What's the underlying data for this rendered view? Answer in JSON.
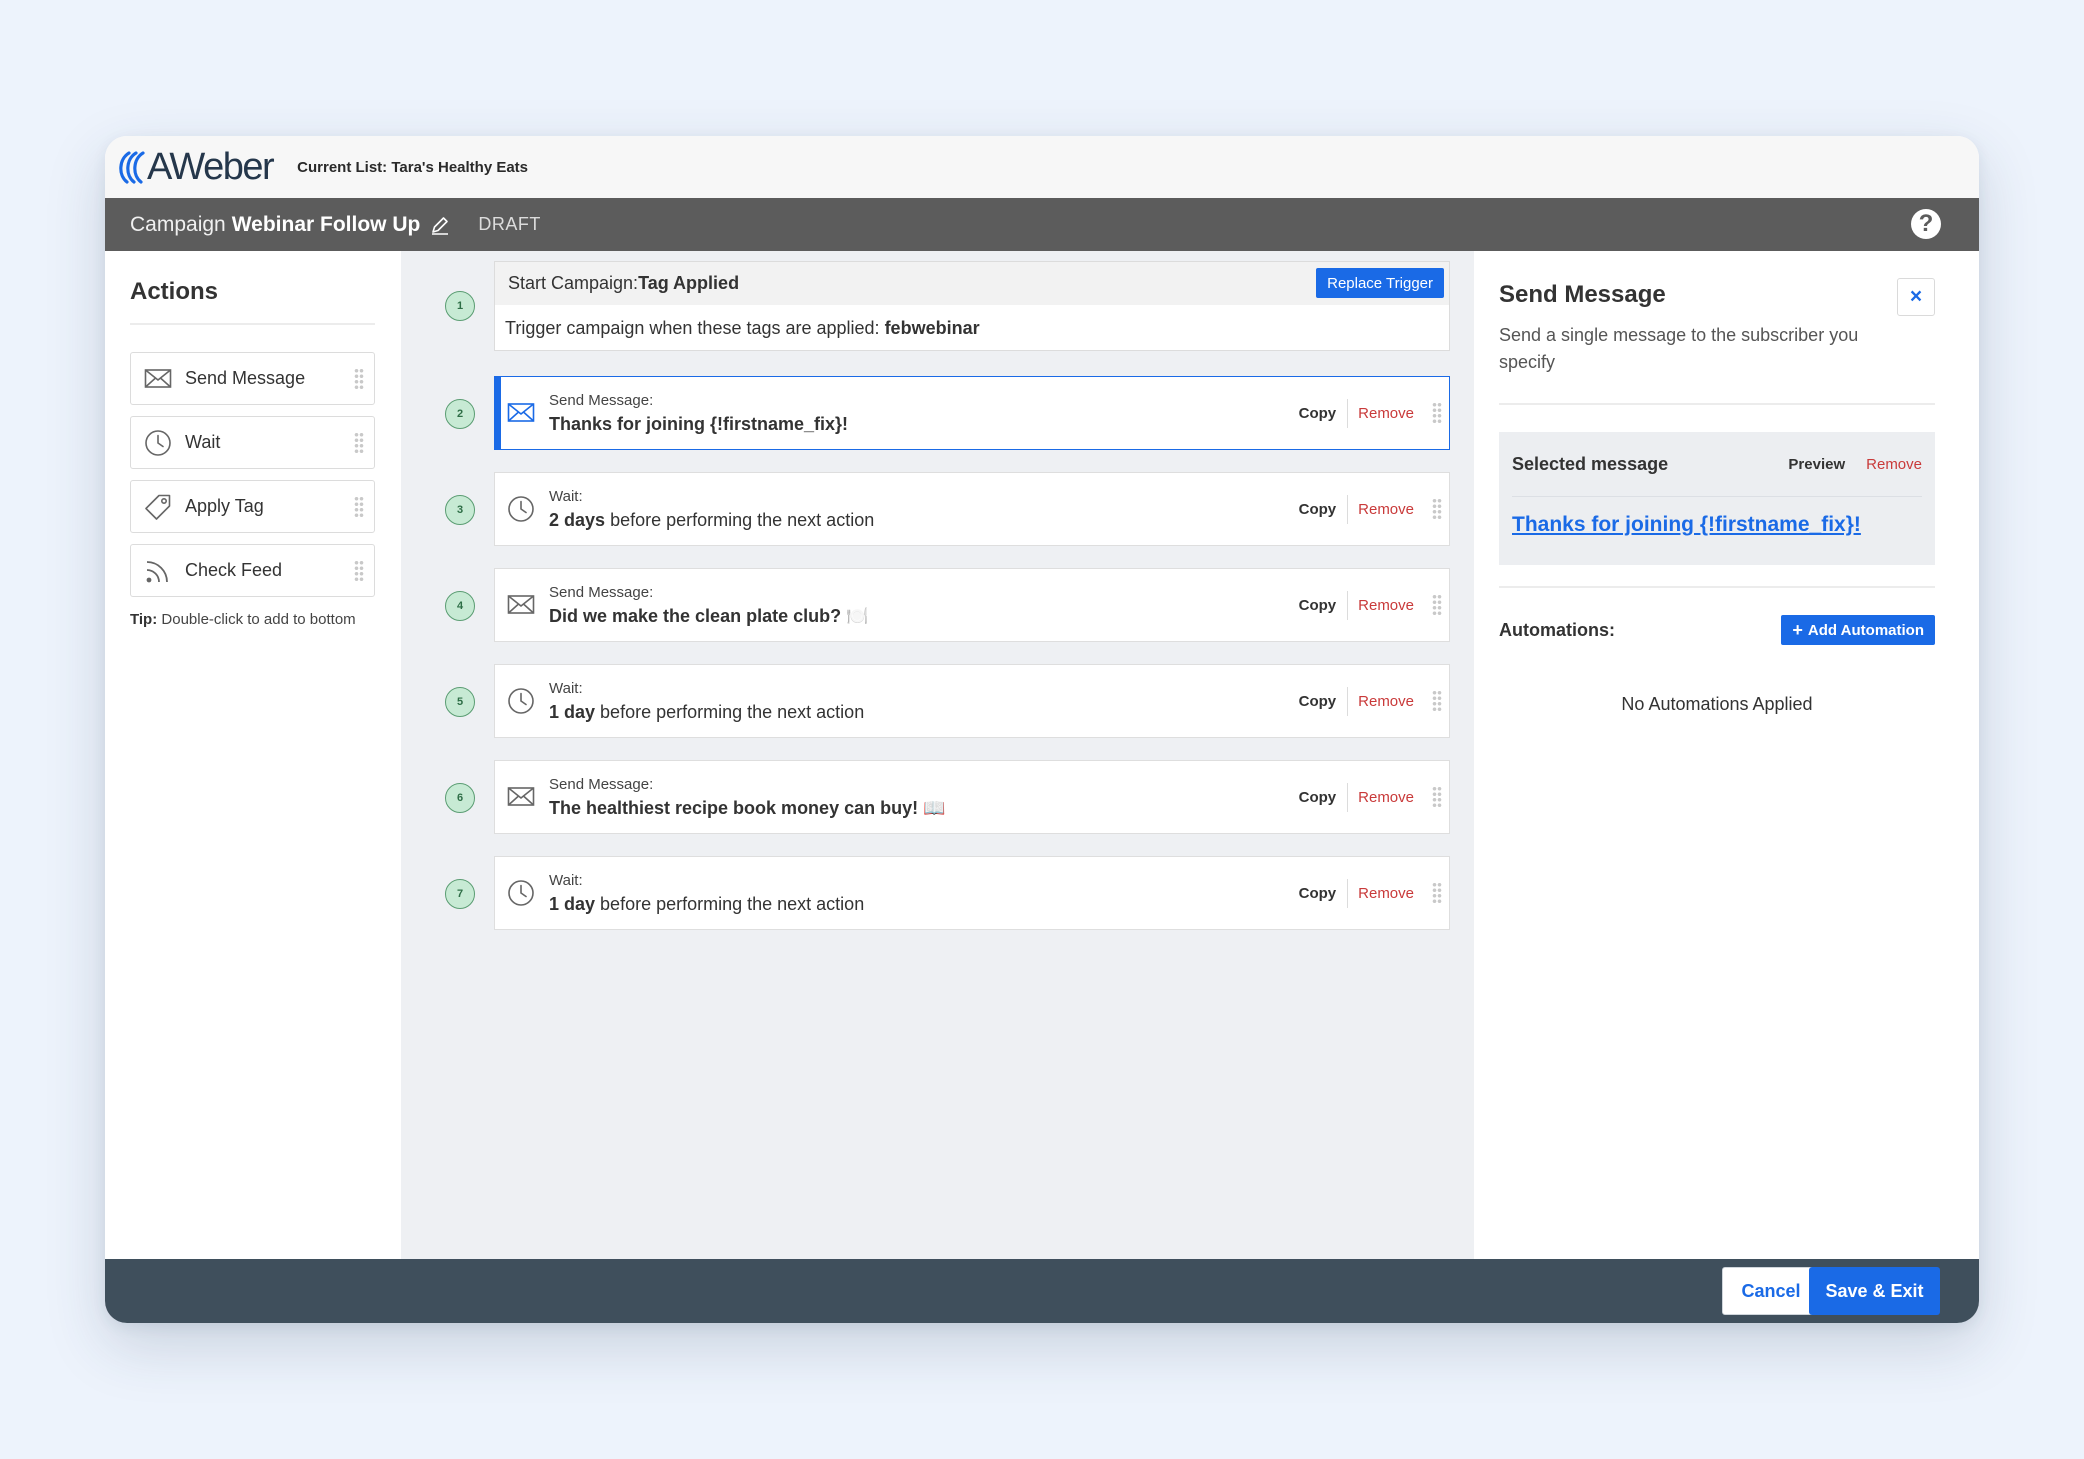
{
  "app": {
    "logo_text": "AWeber",
    "current_list": "Current List: Tara's Healthy Eats"
  },
  "campaign_bar": {
    "prefix": "Campaign",
    "name": "Webinar Follow Up",
    "status": "DRAFT",
    "help_label": "?"
  },
  "sidebar": {
    "title": "Actions",
    "items": [
      {
        "label": "Send Message",
        "icon": "envelope-icon"
      },
      {
        "label": "Wait",
        "icon": "clock-icon"
      },
      {
        "label": "Apply Tag",
        "icon": "tag-icon"
      },
      {
        "label": "Check Feed",
        "icon": "rss-icon"
      }
    ],
    "tip_label": "Tip:",
    "tip_text": "Double-click to add to bottom"
  },
  "trigger": {
    "number": "1",
    "head_prefix": "Start Campaign:",
    "head_value": "Tag Applied",
    "button_label": "Replace Trigger",
    "body_prefix": "Trigger campaign when these tags are applied:",
    "body_value": "febwebinar"
  },
  "steps": [
    {
      "number": "2",
      "type": "Send Message:",
      "bold": "Thanks for joining {!firstname_fix}!",
      "rest": "",
      "copy": "Copy",
      "remove": "Remove",
      "selected": true,
      "icon": "envelope-icon"
    },
    {
      "number": "3",
      "type": "Wait:",
      "bold": "2 days",
      "rest": "before performing the next action",
      "copy": "Copy",
      "remove": "Remove",
      "selected": false,
      "icon": "clock-icon"
    },
    {
      "number": "4",
      "type": "Send Message:",
      "bold": "Did we make the clean plate club? 🍽️",
      "rest": "",
      "copy": "Copy",
      "remove": "Remove",
      "selected": false,
      "icon": "envelope-icon"
    },
    {
      "number": "5",
      "type": "Wait:",
      "bold": "1 day",
      "rest": "before performing the next action",
      "copy": "Copy",
      "remove": "Remove",
      "selected": false,
      "icon": "clock-icon"
    },
    {
      "number": "6",
      "type": "Send Message:",
      "bold": "The healthiest recipe book money can buy! 📖",
      "rest": "",
      "copy": "Copy",
      "remove": "Remove",
      "selected": false,
      "icon": "envelope-icon"
    },
    {
      "number": "7",
      "type": "Wait:",
      "bold": "1 day",
      "rest": "before performing the next action",
      "copy": "Copy",
      "remove": "Remove",
      "selected": false,
      "icon": "clock-icon"
    }
  ],
  "panel": {
    "title": "Send Message",
    "description": "Send a single message to the subscriber you specify",
    "close_label": "×",
    "selected_title": "Selected message",
    "preview_label": "Preview",
    "remove_label": "Remove",
    "message_link": "Thanks for joining {!firstname_fix}!",
    "automations_label": "Automations:",
    "add_automation_label": "Add Automation",
    "add_automation_plus": "+",
    "no_automations": "No Automations Applied"
  },
  "footer": {
    "cancel_label": "Cancel",
    "save_label": "Save & Exit"
  },
  "colors": {
    "accent": "#1a6ae6",
    "danger": "#c93a3a",
    "step_badge": "#c7ead4",
    "footer": "#3f4f5c",
    "campaign_bar": "#5c5c5c"
  }
}
